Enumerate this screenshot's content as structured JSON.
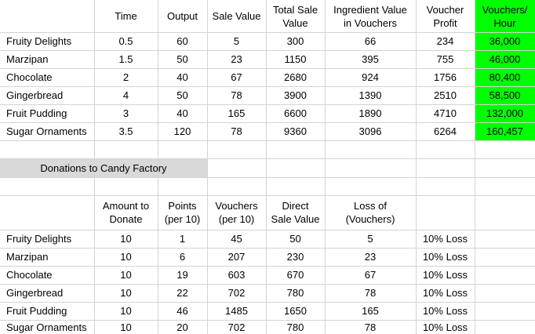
{
  "sheet": {
    "top_table": {
      "headers": {
        "time": "Time",
        "output": "Output",
        "sale_value": "Sale Value",
        "total_sale_value": [
          "Total Sale",
          "Value"
        ],
        "ingredient_value": [
          "Ingredient Value",
          "in Vouchers"
        ],
        "voucher_profit": [
          "Voucher",
          "Profit"
        ],
        "vouchers_per_hour": [
          "Vouchers/",
          "Hour"
        ]
      },
      "rows": [
        {
          "name": "Fruity Delights",
          "time": "0.5",
          "output": "60",
          "sale_value": "5",
          "total": "300",
          "ingredient": "66",
          "profit": "234",
          "per_hour": "36,000"
        },
        {
          "name": "Marzipan",
          "time": "1.5",
          "output": "50",
          "sale_value": "23",
          "total": "1150",
          "ingredient": "395",
          "profit": "755",
          "per_hour": "46,000"
        },
        {
          "name": "Chocolate",
          "time": "2",
          "output": "40",
          "sale_value": "67",
          "total": "2680",
          "ingredient": "924",
          "profit": "1756",
          "per_hour": "80,400"
        },
        {
          "name": "Gingerbread",
          "time": "4",
          "output": "50",
          "sale_value": "78",
          "total": "3900",
          "ingredient": "1390",
          "profit": "2510",
          "per_hour": "58,500"
        },
        {
          "name": "Fruit Pudding",
          "time": "3",
          "output": "40",
          "sale_value": "165",
          "total": "6600",
          "ingredient": "1890",
          "profit": "4710",
          "per_hour": "132,000"
        },
        {
          "name": "Sugar Ornaments",
          "time": "3.5",
          "output": "120",
          "sale_value": "78",
          "total": "9360",
          "ingredient": "3096",
          "profit": "6264",
          "per_hour": "160,457"
        }
      ]
    },
    "section_title": "Donations to Candy Factory",
    "bottom_table": {
      "headers": {
        "amount": [
          "Amount to",
          "Donate"
        ],
        "points": [
          "Points",
          "(per 10)"
        ],
        "vouchers": [
          "Vouchers",
          "(per 10)"
        ],
        "direct": [
          "Direct",
          "Sale Value"
        ],
        "loss": [
          "Loss of",
          "(Vouchers)"
        ]
      },
      "rows": [
        {
          "name": "Fruity Delights",
          "amount": "10",
          "points": "1",
          "vouchers": "45",
          "direct": "50",
          "loss": "5",
          "pct": "10% Loss"
        },
        {
          "name": "Marzipan",
          "amount": "10",
          "points": "6",
          "vouchers": "207",
          "direct": "230",
          "loss": "23",
          "pct": "10% Loss"
        },
        {
          "name": "Chocolate",
          "amount": "10",
          "points": "19",
          "vouchers": "603",
          "direct": "670",
          "loss": "67",
          "pct": "10% Loss"
        },
        {
          "name": "Gingerbread",
          "amount": "10",
          "points": "22",
          "vouchers": "702",
          "direct": "780",
          "loss": "78",
          "pct": "10% Loss"
        },
        {
          "name": "Fruit Pudding",
          "amount": "10",
          "points": "46",
          "vouchers": "1485",
          "direct": "1650",
          "loss": "165",
          "pct": "10% Loss"
        },
        {
          "name": "Sugar Ornaments",
          "amount": "10",
          "points": "20",
          "vouchers": "702",
          "direct": "780",
          "loss": "78",
          "pct": "10% Loss"
        }
      ]
    },
    "colors": {
      "highlight": "#00ff00",
      "section_fill": "#d9d9d9",
      "gridline": "#d4d4d4"
    }
  }
}
